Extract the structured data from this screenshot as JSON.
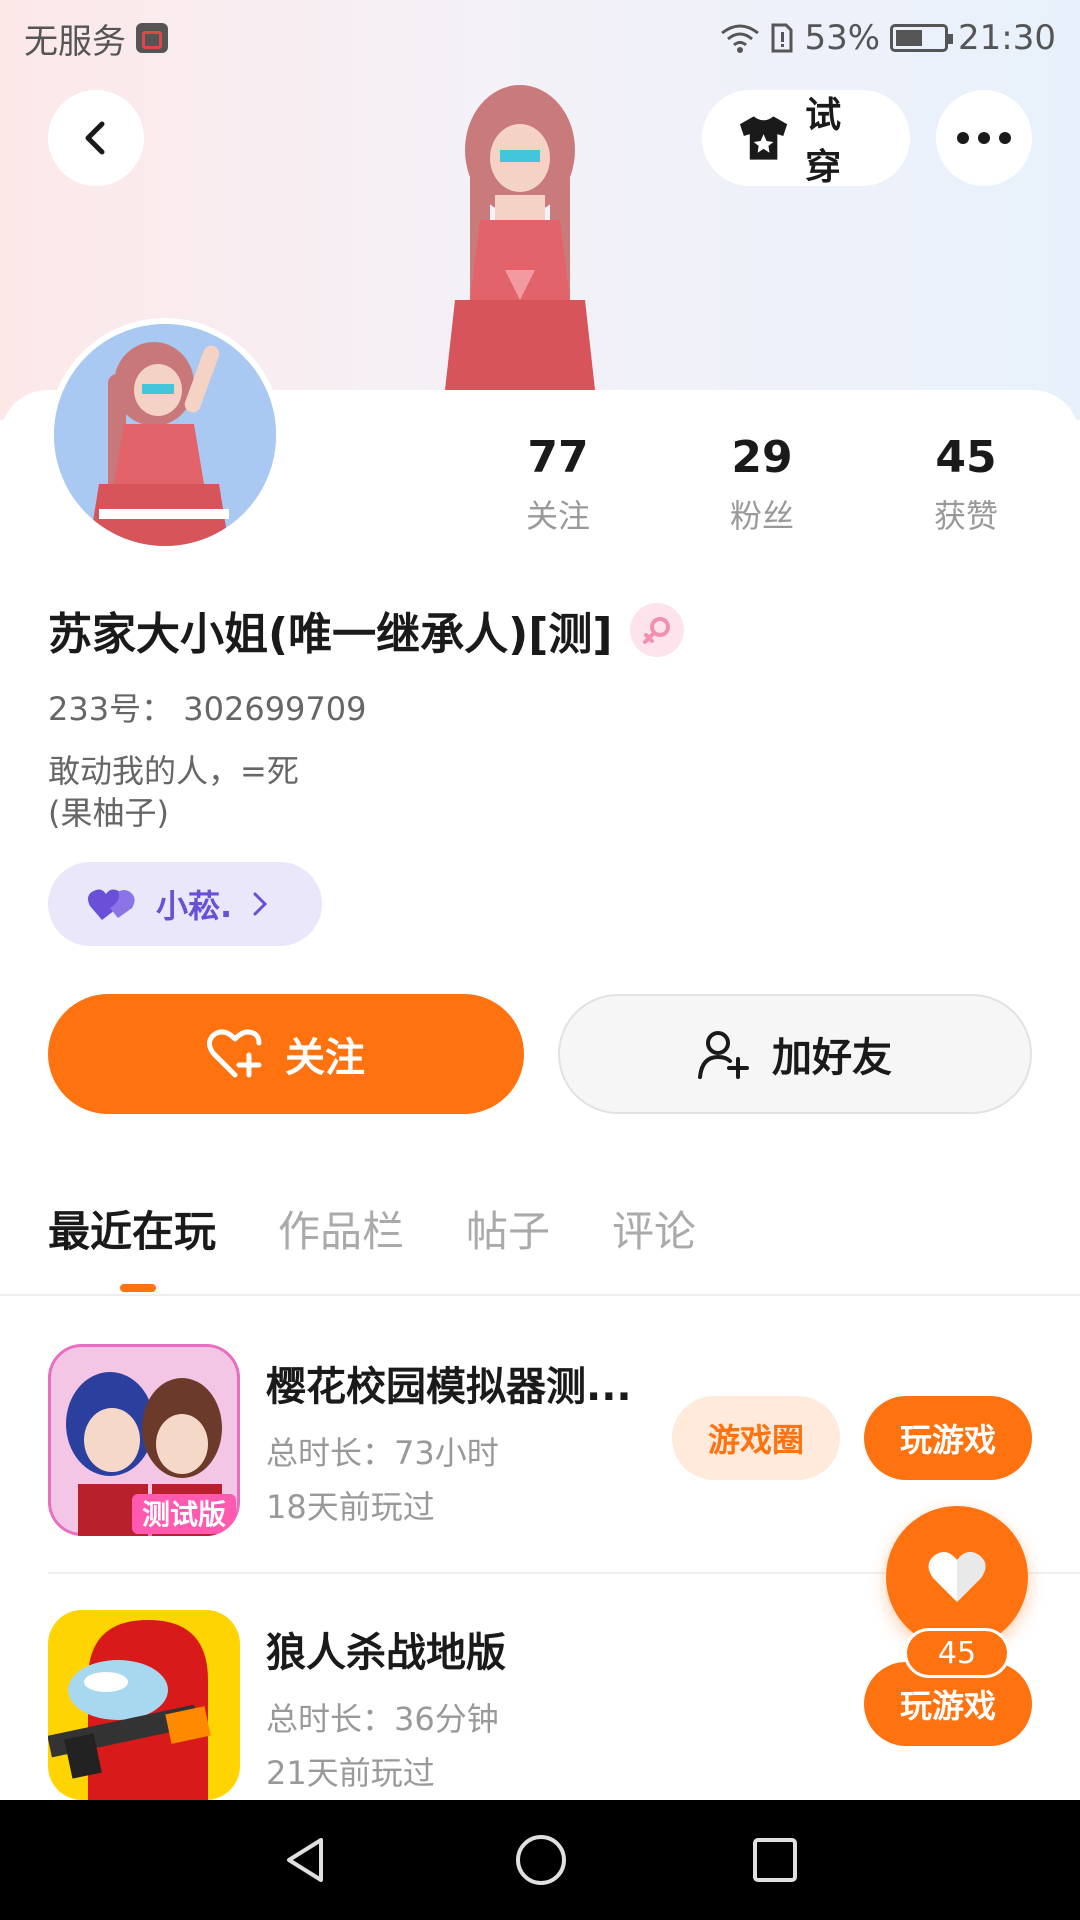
{
  "status_bar": {
    "carrier": "无服务",
    "battery": "53%",
    "time": "21:30"
  },
  "header": {
    "try_on_label": "试穿"
  },
  "profile": {
    "stats": [
      {
        "value": "77",
        "label": "关注"
      },
      {
        "value": "29",
        "label": "粉丝"
      },
      {
        "value": "45",
        "label": "获赞"
      }
    ],
    "name": "苏家大小姐(唯一继承人)[测]",
    "uid": "233号： 302699709",
    "bio_line1": "敢动我的人，=死",
    "bio_line2": "(果柚子)",
    "cp_label": "小菘.",
    "follow_label": "关注",
    "add_friend_label": "加好友"
  },
  "tabs": [
    {
      "label": "最近在玩",
      "active": true
    },
    {
      "label": "作品栏",
      "active": false
    },
    {
      "label": "帖子",
      "active": false
    },
    {
      "label": "评论",
      "active": false
    }
  ],
  "games": [
    {
      "title": "樱花校园模拟器测...",
      "duration": "总时长：73小时",
      "last_played": "18天前玩过",
      "circle_label": "游戏圈",
      "play_label": "玩游戏",
      "icon_badge": "测试版"
    },
    {
      "title": "狼人杀战地版",
      "duration": "总时长：36分钟",
      "last_played": "21天前玩过",
      "play_label": "玩游戏"
    }
  ],
  "like_fab": {
    "count": "45"
  },
  "colors": {
    "accent": "#ff7210",
    "accent_light": "#ffeadb",
    "cp_purple": "#6a4fd8",
    "cp_bg": "#ebe7fb",
    "female_pink": "#f48fb1"
  }
}
